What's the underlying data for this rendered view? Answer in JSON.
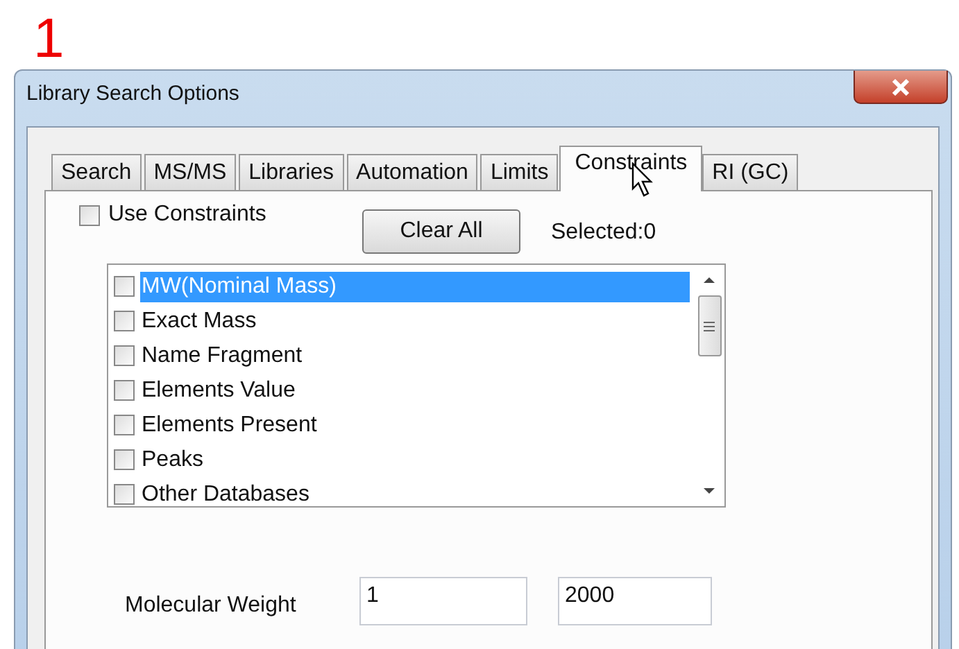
{
  "step_number": "1",
  "window": {
    "title": "Library Search Options"
  },
  "tabs": [
    {
      "label": "Search",
      "selected": false
    },
    {
      "label": "MS/MS",
      "selected": false
    },
    {
      "label": "Libraries",
      "selected": false
    },
    {
      "label": "Automation",
      "selected": false
    },
    {
      "label": "Limits",
      "selected": false
    },
    {
      "label": "Constraints",
      "selected": true
    },
    {
      "label": "RI (GC)",
      "selected": false
    }
  ],
  "use_constraints": {
    "label": "Use Constraints",
    "checked": false
  },
  "clear_all_button": "Clear All",
  "selected_count": "Selected:0",
  "constraints_list": [
    {
      "label": "MW(Nominal Mass)",
      "checked": false,
      "selected": true
    },
    {
      "label": "Exact Mass",
      "checked": false,
      "selected": false
    },
    {
      "label": "Name Fragment",
      "checked": false,
      "selected": false
    },
    {
      "label": "Elements Value",
      "checked": false,
      "selected": false
    },
    {
      "label": "Elements Present",
      "checked": false,
      "selected": false
    },
    {
      "label": "Peaks",
      "checked": false,
      "selected": false
    },
    {
      "label": "Other Databases",
      "checked": false,
      "selected": false
    }
  ],
  "molecular_weight": {
    "label": "Molecular Weight",
    "min": "1",
    "max": "2000"
  }
}
